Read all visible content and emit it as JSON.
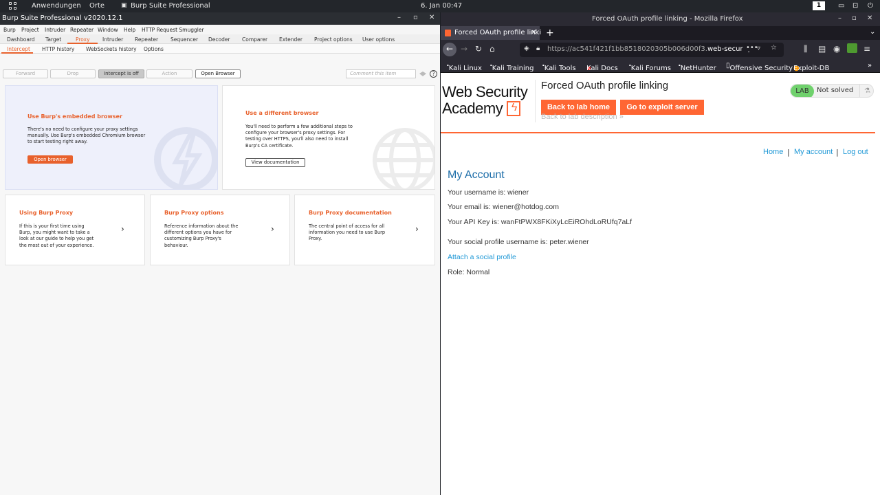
{
  "system_bar": {
    "apps_label": "Anwendungen",
    "places_label": "Orte",
    "active_app": "Burp Suite Professional",
    "clock": "6. Jan 00:47",
    "workspace": "1"
  },
  "burp": {
    "window_title": "Burp Suite Professional v2020.12.1",
    "menu": [
      "Burp",
      "Project",
      "Intruder",
      "Repeater",
      "Window",
      "Help",
      "HTTP Request Smuggler"
    ],
    "tabs": [
      "Dashboard",
      "Target",
      "Proxy",
      "Intruder",
      "Repeater",
      "Sequencer",
      "Decoder",
      "Comparer",
      "Extender",
      "Project options",
      "User options"
    ],
    "active_tab": "Proxy",
    "subtabs": [
      "Intercept",
      "HTTP history",
      "WebSockets history",
      "Options"
    ],
    "active_subtab": "Intercept",
    "buttons": {
      "forward": "Forward",
      "drop": "Drop",
      "intercept": "Intercept is off",
      "action": "Action",
      "open_browser": "Open Browser"
    },
    "comment_placeholder": "Comment this item",
    "help_glyph": "?",
    "card_embedded": {
      "title": "Use Burp's embedded browser",
      "text_lines": [
        "There's no need to configure your proxy settings",
        "manually. Use Burp's embedded Chromium browser",
        "to start testing right away."
      ],
      "button": "Open browser"
    },
    "card_different": {
      "title": "Use a different browser",
      "text_lines": [
        "You'll need to perform a few additional steps to",
        "configure your browser's proxy settings. For",
        "testing over HTTPS, you'll also need to install",
        "Burp's CA certificate."
      ],
      "button": "View documentation"
    },
    "card_using": {
      "title": "Using Burp Proxy",
      "text_lines": [
        "If this is your first time using",
        "Burp, you might want to take a",
        "look at our guide to help you get",
        "the most out of your experience."
      ]
    },
    "card_options": {
      "title": "Burp Proxy options",
      "text_lines": [
        "Reference information about the",
        "different options you have for",
        "customizing Burp Proxy's",
        "behaviour."
      ]
    },
    "card_docs": {
      "title": "Burp Proxy documentation",
      "text_lines": [
        "The central point of access for all",
        "information you need to use Burp",
        "Proxy."
      ]
    },
    "colors": {
      "accent": "#e8612c",
      "embedded_card_bg": "#eef0fb"
    }
  },
  "firefox": {
    "window_title": "Forced OAuth profile linking - Mozilla Firefox",
    "tab_title": "Forced OAuth profile linki",
    "url_dim": "https://ac541f421f1bb8518020305b006d00f3.",
    "url_bright": "web-security",
    "bookmarks": [
      "Kali Linux",
      "Kali Training",
      "Kali Tools",
      "Kali Docs",
      "Kali Forums",
      "NetHunter",
      "Offensive Security",
      "Exploit-DB"
    ],
    "page": {
      "logo_line1": "Web Security",
      "logo_line2": "Academy",
      "title": "Forced OAuth profile linking",
      "back_to_lab_home": "Back to lab home",
      "go_to_exploit_server": "Go to exploit server",
      "back_to_lab_description": "Back to lab description »",
      "lab_badge": "LAB",
      "lab_status": "Not solved",
      "nav": {
        "home": "Home",
        "my_account": "My account",
        "log_out": "Log out",
        "separator": "|"
      },
      "heading": "My Account",
      "username": "Your username is: wiener",
      "email": "Your email is: wiener@hotdog.com",
      "api_key": "Your API Key is: wanFtPWX8FKiXyLcEiROhdLoRUfq7aLf",
      "social_username": "Your social profile username is: peter.wiener",
      "attach_social": "Attach a social profile",
      "role": "Role: Normal"
    },
    "colors": {
      "lab_button": "#ff6633",
      "link": "#1f98d6",
      "heading": "#1b6ca8",
      "lab_badge": "#70d16d"
    }
  }
}
